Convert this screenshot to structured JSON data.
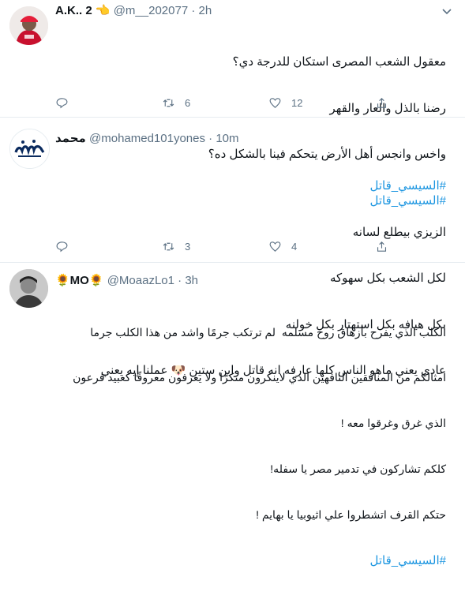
{
  "tweets": [
    {
      "name": "A.K.. 2 👈",
      "handle": "@m__202077",
      "dot": "·",
      "time": "2h",
      "lines": [
        "معقول الشعب المصرى استكان للدرجة دي؟",
        "رضنا بالذل والعار والقهر",
        "واخس وانجس أهل الأرض يتحكم فينا بالشكل ده؟"
      ],
      "hashtag": "#السيسي_قاتل",
      "actions": {
        "reply": "",
        "retweet": "6",
        "like": "12"
      }
    },
    {
      "name": "محمد",
      "handle": "@mohamed101yones",
      "dot": "·",
      "time": "10m",
      "hashtag": "#السيسي_قاتل",
      "lines": [
        "الزيزي بيطلع لسانه",
        "لكل الشعب بكل سهوكه",
        "بكل هيافه بكل استهتار بكل خولنه",
        "عادي يعني ماهو الناس كلها عارفه انه قاتل وابن ستين 🐶 عملنا إيه يعني"
      ],
      "actions": {
        "reply": "",
        "retweet": "3",
        "like": "4"
      }
    },
    {
      "name": "🌻MO🌻",
      "handle": "@MoaazLo1",
      "dot": "·",
      "time": "3h",
      "lines": [
        "الكلب الذي يفرح بازهاق روح مسلمه  لم ترتكب جرمًا واشد من هذا الكلب جرما",
        "امثالكم من المنافقين التافهين الذي لاينكرون منكرًا ولا يعرفون معروفًا كعبيد فرعون",
        "الذي غرق وغرقوا معه !",
        "كلكم تشاركون في تدمير مصر يا سفله!",
        "حتكم القرف اتشطروا علي اثيوبيا يا بهايم !"
      ],
      "hashtag": "#السيسي_قاتل",
      "actions": {
        "reply": "",
        "retweet": "",
        "like": ""
      }
    }
  ],
  "colors": {
    "link": "#1b95e0",
    "muted": "#5b7083",
    "divider": "#e6ecf0"
  }
}
